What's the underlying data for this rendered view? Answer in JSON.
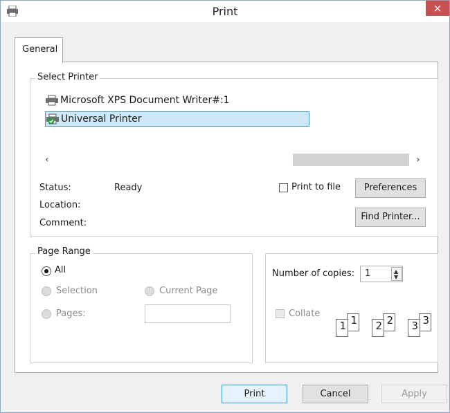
{
  "window": {
    "title": "Print",
    "close_label": "×"
  },
  "tabs": [
    {
      "label": "General",
      "active": true
    }
  ],
  "select_printer": {
    "group_label": "Select Printer",
    "printers": [
      {
        "name": "Microsoft XPS Document Writer#:1",
        "icon": "printer-icon",
        "selected": false
      },
      {
        "name": "Universal Printer",
        "icon": "printer-default-icon",
        "selected": true
      }
    ],
    "scroll_left": "‹",
    "scroll_right": "›"
  },
  "printer_info": {
    "status_label": "Status:",
    "status_value": "Ready",
    "location_label": "Location:",
    "location_value": "",
    "comment_label": "Comment:",
    "comment_value": ""
  },
  "print_to_file": {
    "label": "Print to file",
    "checked": false
  },
  "buttons": {
    "preferences": "Preferences",
    "find_printer": "Find Printer...",
    "print": "Print",
    "cancel": "Cancel",
    "apply": "Apply"
  },
  "page_range": {
    "group_label": "Page Range",
    "all_label": "All",
    "selection_label": "Selection",
    "current_page_label": "Current Page",
    "pages_label": "Pages:",
    "pages_value": "",
    "selected": "all"
  },
  "copies": {
    "label": "Number of copies:",
    "value": "1",
    "collate_label": "Collate",
    "collate_checked": false,
    "collate_pages": [
      {
        "back": "1",
        "front": "1"
      },
      {
        "back": "2",
        "front": "2"
      },
      {
        "back": "3",
        "front": "3"
      }
    ]
  },
  "colors": {
    "accent": "#3c98cf",
    "selection_bg": "#cfe8f8",
    "close_bg": "#c75050",
    "dialog_bg": "#f0f0f0"
  }
}
